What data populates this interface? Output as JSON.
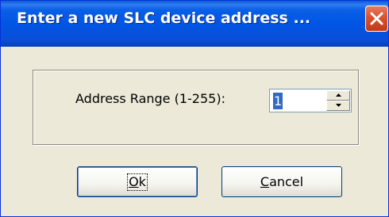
{
  "dialog": {
    "title": "Enter a new SLC device address ...",
    "close_icon": "close-x-icon"
  },
  "address": {
    "label": "Address Range (1-255):",
    "value": "1",
    "spin_up_icon": "triangle-up-icon",
    "spin_down_icon": "triangle-down-icon"
  },
  "buttons": {
    "ok_label": "Ok",
    "cancel_label": "Cancel"
  },
  "colors": {
    "titlebar": "#0055e5",
    "close_button": "#d9522f",
    "dialog_bg": "#ece9d8",
    "selection": "#316ac5"
  }
}
